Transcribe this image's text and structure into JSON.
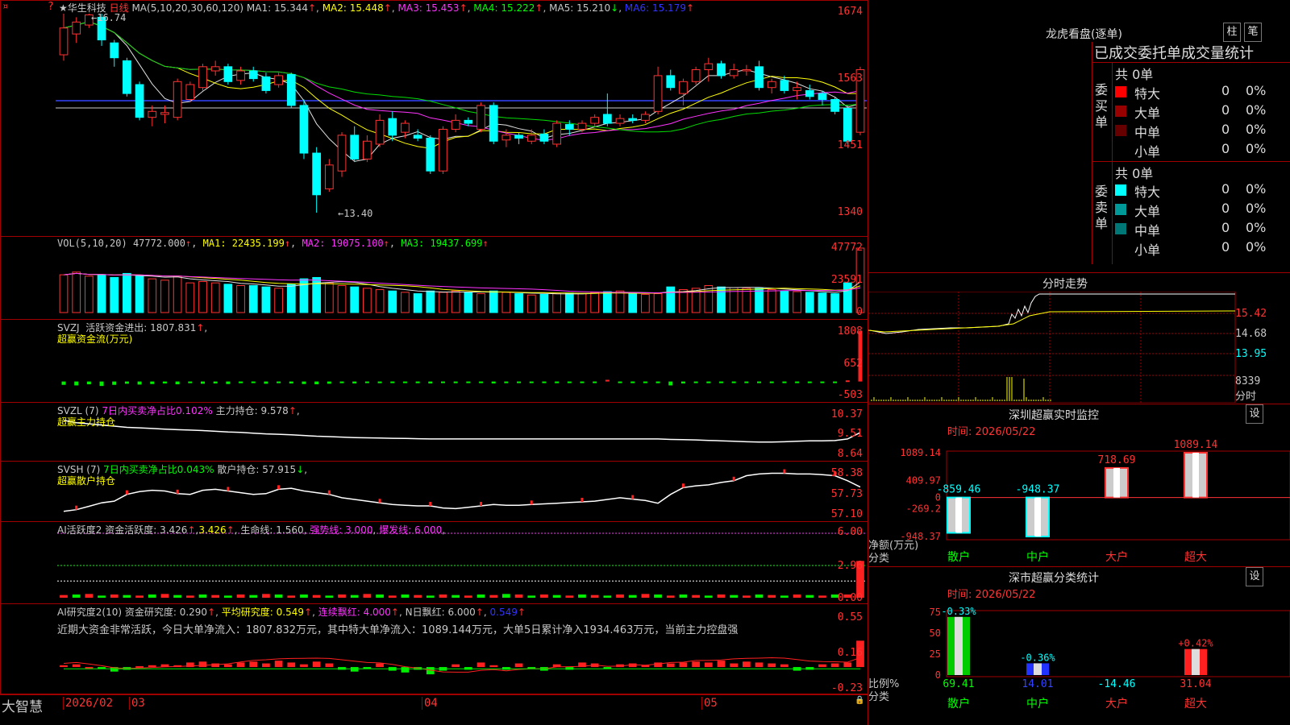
{
  "header": {
    "star": "★",
    "name": "华生科技",
    "period": "日线",
    "ma_label": "MA(5,10,20,30,60,120)",
    "ma": [
      {
        "k": "MA1:",
        "v": "15.344"
      },
      {
        "k": "MA2:",
        "v": "15.448"
      },
      {
        "k": "MA3:",
        "v": "15.453"
      },
      {
        "k": "MA4:",
        "v": "15.222"
      },
      {
        "k": "MA5:",
        "v": "15.210"
      },
      {
        "k": "MA6:",
        "v": "15.179"
      }
    ],
    "arrows": [
      "↑",
      "↑",
      "↑",
      "↑",
      "↓",
      "↑"
    ],
    "corner_q": "?",
    "corner_mark": "¤"
  },
  "price": {
    "axis": [
      "1674",
      "1563",
      "1451",
      "1340"
    ],
    "high_label": "16.74",
    "low_label": "13.40"
  },
  "vol": {
    "label": "VOL(5,10,20)",
    "value": "47772.000",
    "ma1": "MA1: 22435.199",
    "ma2": "MA2: 19075.100",
    "ma3": "MA3: 19437.699",
    "arrow": "↑",
    "axis": [
      "47772",
      "23591",
      "0"
    ]
  },
  "svzj": {
    "label": "SVZJ",
    "text": "活跃资金进出: 1807.831",
    "arrow": "↑",
    "comma": ",",
    "sub": "超赢资金流(万元)",
    "axis": [
      "1808",
      "652",
      "-503"
    ]
  },
  "svzl": {
    "label": "SVZL (7)",
    "t1": "7日内买卖净占比0.102%",
    "t2": "主力持仓: 9.578",
    "arrow": "↑",
    "comma": ",",
    "sub": "超赢主力持仓",
    "axis": [
      "10.37",
      "9.51",
      "8.64"
    ]
  },
  "svsh": {
    "label": "SVSH (7)",
    "t1": "7日内买卖净占比0.043%",
    "t2": "散户持仓: 57.915",
    "arrow": "↓",
    "comma": ",",
    "sub": "超赢散户持仓",
    "axis": [
      "58.38",
      "57.73",
      "57.10"
    ]
  },
  "ai1": {
    "label": "AI活跃度2",
    "t1": "资金活跃度: 3.426",
    "t2": "3.426",
    "t3": "生命线: 1.560",
    "t4": "强势线: 3.000",
    "t5": "爆发线: 6.000",
    "arrow": "↑",
    "comma": ",",
    "axis": [
      "6.00",
      "2.96",
      "0.00"
    ]
  },
  "ai2": {
    "label": "AI研究度2(10)",
    "t1": "资金研究度: 0.290",
    "t2": "平均研究度: 0.549",
    "t3": "连续飘红: 4.000",
    "t4": "N日飘红: 6.000",
    "t5": "0.549",
    "arrow": "↑",
    "comma": ",",
    "note": "近期大资金非常活跃，今日大单净流入：1807.832万元，其中特大单净流入：1089.144万元，大单5日累计净入1934.463万元，当前主力控盘强",
    "axis": [
      "0.55",
      "0.16",
      "-0.23"
    ]
  },
  "footer": {
    "brand": "大智慧",
    "dates": [
      "2026/02",
      "03",
      "04",
      "05"
    ],
    "lock": "🔒"
  },
  "right": {
    "title": "龙虎看盘(逐单)",
    "btn1": "柱",
    "btn2": "笔",
    "tabs": "已成交委托单成交量统计",
    "buy": {
      "side": "委买单",
      "total": "共 0单",
      "rows": [
        {
          "n": "特大",
          "c": "#ff0000",
          "v": "0",
          "p": "0%"
        },
        {
          "n": "大单",
          "c": "#990000",
          "v": "0",
          "p": "0%"
        },
        {
          "n": "中单",
          "c": "#660000",
          "v": "0",
          "p": "0%"
        },
        {
          "n": "小单",
          "c": "",
          "v": "0",
          "p": "0%"
        }
      ]
    },
    "sell": {
      "side": "委卖单",
      "total": "共 0单",
      "rows": [
        {
          "n": "特大",
          "c": "#00ffff",
          "v": "0",
          "p": "0%"
        },
        {
          "n": "大单",
          "c": "#009999",
          "v": "0",
          "p": "0%"
        },
        {
          "n": "中单",
          "c": "#007777",
          "v": "0",
          "p": "0%"
        },
        {
          "n": "小单",
          "c": "",
          "v": "0",
          "p": "0%"
        }
      ]
    },
    "intraday": {
      "title": "分时走势",
      "axis": [
        "15.42",
        "14.68",
        "13.95"
      ],
      "vol": "8339",
      "unit": "分时"
    },
    "monitor": {
      "title": "深圳超赢实时监控",
      "btn": "设",
      "time": "时间: 2026/05/22",
      "axis": [
        "1089.14",
        "409.97",
        "0",
        "-269.2",
        "-948.37"
      ],
      "ylabel": "净额(万元)",
      "xlabel": "分类",
      "bars": [
        {
          "name": "散户",
          "value": -859.46,
          "label": "-859.46"
        },
        {
          "name": "中户",
          "value": -948.37,
          "label": "-948.37"
        },
        {
          "name": "大户",
          "value": 718.69,
          "label": "718.69"
        },
        {
          "name": "超大",
          "value": 1089.14,
          "label": "1089.14"
        }
      ]
    },
    "stats": {
      "title": "深市超赢分类统计",
      "btn": "设",
      "time": "时间: 2026/05/22",
      "axis": [
        "75",
        "50",
        "25",
        "0"
      ],
      "ylabel": "比例%",
      "xlabel": "分类",
      "bars": [
        {
          "name": "散户",
          "value": 69.41,
          "label": "69.41",
          "chg": "-0.33%"
        },
        {
          "name": "中户",
          "value": 14.01,
          "label": "14.01",
          "chg": "-0.36%"
        },
        {
          "name": "大户",
          "value": -14.46,
          "label": "-14.46",
          "chg": ""
        },
        {
          "name": "超大",
          "value": 31.04,
          "label": "31.04",
          "chg": "+0.42%"
        }
      ]
    }
  },
  "chart_data": {
    "type": "candlestick",
    "candles": [
      [
        16.05,
        16.5,
        16.74,
        15.95
      ],
      [
        16.4,
        16.6,
        16.68,
        16.25
      ],
      [
        16.55,
        16.72,
        16.74,
        16.5
      ],
      [
        16.68,
        16.3,
        16.74,
        16.2
      ],
      [
        16.25,
        16.0,
        16.3,
        15.85
      ],
      [
        15.95,
        15.4,
        16.0,
        15.35
      ],
      [
        15.55,
        15.0,
        15.6,
        14.95
      ],
      [
        15.0,
        15.1,
        15.2,
        14.85
      ],
      [
        15.05,
        15.08,
        15.2,
        14.9
      ],
      [
        15.0,
        15.6,
        15.65,
        14.95
      ],
      [
        15.3,
        15.55,
        15.6,
        15.25
      ],
      [
        15.5,
        15.85,
        15.9,
        15.45
      ],
      [
        15.78,
        15.85,
        15.95,
        15.7
      ],
      [
        15.85,
        15.6,
        15.9,
        15.55
      ],
      [
        15.62,
        15.78,
        15.85,
        15.55
      ],
      [
        15.78,
        15.65,
        15.85,
        15.6
      ],
      [
        15.68,
        15.45,
        15.75,
        15.4
      ],
      [
        15.55,
        15.7,
        15.75,
        15.5
      ],
      [
        15.72,
        15.2,
        15.75,
        15.15
      ],
      [
        15.2,
        14.4,
        15.3,
        14.3
      ],
      [
        14.4,
        13.7,
        14.5,
        13.4
      ],
      [
        13.8,
        14.2,
        14.3,
        13.75
      ],
      [
        14.1,
        14.7,
        14.75,
        14.0
      ],
      [
        14.7,
        14.3,
        14.85,
        14.25
      ],
      [
        14.3,
        14.6,
        14.7,
        14.25
      ],
      [
        14.55,
        14.95,
        15.05,
        14.5
      ],
      [
        14.98,
        14.7,
        15.1,
        14.6
      ],
      [
        14.75,
        14.9,
        14.95,
        14.65
      ],
      [
        14.7,
        14.65,
        14.8,
        14.6
      ],
      [
        14.65,
        14.1,
        14.7,
        14.05
      ],
      [
        14.1,
        14.8,
        14.85,
        14.05
      ],
      [
        14.8,
        14.95,
        15.05,
        14.75
      ],
      [
        14.95,
        14.9,
        15.0,
        14.85
      ],
      [
        14.8,
        15.2,
        15.25,
        14.75
      ],
      [
        15.2,
        14.6,
        15.25,
        14.55
      ],
      [
        14.62,
        14.7,
        14.8,
        14.5
      ],
      [
        14.7,
        14.65,
        14.75,
        14.55
      ],
      [
        14.6,
        14.7,
        14.8,
        14.55
      ],
      [
        14.72,
        14.6,
        14.8,
        14.55
      ],
      [
        14.55,
        14.9,
        14.95,
        14.5
      ],
      [
        14.88,
        14.8,
        14.95,
        14.7
      ],
      [
        14.8,
        14.9,
        14.95,
        14.75
      ],
      [
        14.9,
        15.0,
        15.05,
        14.85
      ],
      [
        15.05,
        14.9,
        15.4,
        14.85
      ],
      [
        14.9,
        14.98,
        15.05,
        14.85
      ],
      [
        14.98,
        14.95,
        15.05,
        14.9
      ],
      [
        14.95,
        15.05,
        15.1,
        14.9
      ],
      [
        15.1,
        15.7,
        15.85,
        15.05
      ],
      [
        15.7,
        15.5,
        15.8,
        15.45
      ],
      [
        15.4,
        15.6,
        15.65,
        15.2
      ],
      [
        15.6,
        15.8,
        15.85,
        15.55
      ],
      [
        15.8,
        15.9,
        16.0,
        15.6
      ],
      [
        15.9,
        15.7,
        15.95,
        15.65
      ],
      [
        15.7,
        15.8,
        15.9,
        15.65
      ],
      [
        15.78,
        15.8,
        15.88,
        15.7
      ],
      [
        15.85,
        15.5,
        15.95,
        15.45
      ],
      [
        15.5,
        15.6,
        15.65,
        15.4
      ],
      [
        15.62,
        15.45,
        15.7,
        15.4
      ],
      [
        15.45,
        15.5,
        15.6,
        15.3
      ],
      [
        15.45,
        15.35,
        15.55,
        15.3
      ],
      [
        15.4,
        15.3,
        15.45,
        15.2
      ],
      [
        15.3,
        15.1,
        15.35,
        15.05
      ],
      [
        15.15,
        14.6,
        15.2,
        14.55
      ],
      [
        14.75,
        15.8,
        15.85,
        14.7
      ]
    ],
    "volume": [
      28000,
      30000,
      27000,
      28000,
      26000,
      29000,
      27000,
      25000,
      24000,
      27000,
      22000,
      23000,
      22000,
      21000,
      20000,
      20000,
      19000,
      18000,
      21000,
      25000,
      26000,
      22000,
      20000,
      19000,
      18000,
      17000,
      16000,
      15000,
      14000,
      16000,
      15000,
      16000,
      15000,
      14000,
      16000,
      15000,
      14000,
      13000,
      13500,
      14000,
      14500,
      14000,
      15000,
      15500,
      16000,
      14000,
      13500,
      14000,
      19000,
      17000,
      18000,
      20000,
      19000,
      18500,
      18000,
      18000,
      17000,
      16000,
      15500,
      15000,
      14500,
      14000,
      22000,
      47772
    ],
    "svzj": [
      -120,
      -140,
      -100,
      -160,
      -120,
      -80,
      -110,
      -90,
      -70,
      -100,
      -60,
      -80,
      -70,
      -90,
      -60,
      -50,
      -80,
      -60,
      -70,
      -90,
      -100,
      -80,
      -60,
      -70,
      -50,
      -60,
      -40,
      -50,
      -60,
      -70,
      -50,
      -60,
      -40,
      -50,
      -70,
      -60,
      -50,
      -40,
      -50,
      -60,
      -50,
      -40,
      -50,
      60,
      -40,
      -50,
      -40,
      -60,
      -140,
      -70,
      -50,
      -60,
      -40,
      -50,
      -40,
      -50,
      -40,
      -30,
      -40,
      -30,
      -20,
      -40,
      40,
      1808
    ],
    "svzl": [
      10.1,
      10.0,
      9.95,
      9.9,
      9.85,
      9.8,
      9.78,
      9.75,
      9.72,
      9.7,
      9.68,
      9.66,
      9.63,
      9.6,
      9.58,
      9.55,
      9.52,
      9.5,
      9.48,
      9.45,
      9.42,
      9.4,
      9.38,
      9.36,
      9.35,
      9.34,
      9.33,
      9.32,
      9.31,
      9.3,
      9.3,
      9.3,
      9.3,
      9.3,
      9.3,
      9.3,
      9.3,
      9.3,
      9.3,
      9.3,
      9.3,
      9.3,
      9.3,
      9.3,
      9.3,
      9.3,
      9.3,
      9.3,
      9.28,
      9.27,
      9.26,
      9.24,
      9.22,
      9.2,
      9.18,
      9.17,
      9.17,
      9.18,
      9.2,
      9.22,
      9.22,
      9.23,
      9.3,
      9.578
    ],
    "svsh": [
      57.2,
      57.25,
      57.35,
      57.45,
      57.5,
      57.7,
      57.78,
      57.82,
      57.8,
      57.72,
      57.7,
      57.82,
      57.85,
      57.8,
      57.75,
      57.7,
      57.72,
      57.85,
      57.88,
      57.8,
      57.75,
      57.7,
      57.6,
      57.55,
      57.5,
      57.45,
      57.4,
      57.38,
      57.36,
      57.36,
      57.3,
      57.28,
      57.32,
      57.36,
      57.4,
      57.38,
      57.38,
      57.4,
      57.42,
      57.44,
      57.46,
      57.48,
      57.5,
      57.55,
      57.6,
      57.56,
      57.52,
      57.44,
      57.7,
      57.9,
      57.95,
      57.98,
      58.05,
      58.1,
      58.25,
      58.3,
      58.32,
      58.32,
      58.3,
      58.3,
      58.28,
      58.25,
      58.1,
      57.915
    ],
    "ai1": [
      0.25,
      0.3,
      0.35,
      0.2,
      0.3,
      0.25,
      0.2,
      0.3,
      0.35,
      0.25,
      0.2,
      0.3,
      0.25,
      0.2,
      0.3,
      0.25,
      0.35,
      0.3,
      0.2,
      0.3,
      0.25,
      0.2,
      0.3,
      0.25,
      0.35,
      0.3,
      0.2,
      0.3,
      0.25,
      0.2,
      0.3,
      0.25,
      0.2,
      0.3,
      0.25,
      0.35,
      0.3,
      0.2,
      0.3,
      0.25,
      0.2,
      0.3,
      0.25,
      0.2,
      0.3,
      0.25,
      0.35,
      0.3,
      0.2,
      0.3,
      0.25,
      0.2,
      0.3,
      0.25,
      0.2,
      0.3,
      0.25,
      0.2,
      0.3,
      0.25,
      0.2,
      0.3,
      0.3,
      3.426
    ],
    "ai2": [
      0.02,
      0.03,
      0.0,
      -0.02,
      -0.05,
      -0.03,
      0.01,
      0.02,
      0.03,
      0.02,
      0.05,
      0.06,
      0.04,
      0.03,
      0.05,
      0.06,
      0.04,
      0.07,
      0.05,
      0.03,
      0.06,
      0.04,
      -0.03,
      -0.05,
      -0.02,
      0.04,
      -0.04,
      -0.06,
      -0.03,
      -0.08,
      -0.04,
      0.03,
      -0.03,
      0.05,
      0.02,
      -0.03,
      0.04,
      -0.02,
      -0.04,
      0.03,
      -0.03,
      0.05,
      0.04,
      -0.02,
      0.03,
      0.04,
      0.02,
      0.05,
      0.04,
      0.05,
      0.06,
      0.05,
      0.07,
      0.04,
      0.06,
      0.05,
      0.04,
      0.03,
      -0.04,
      -0.03,
      0.03,
      0.04,
      0.05,
      0.29
    ]
  }
}
